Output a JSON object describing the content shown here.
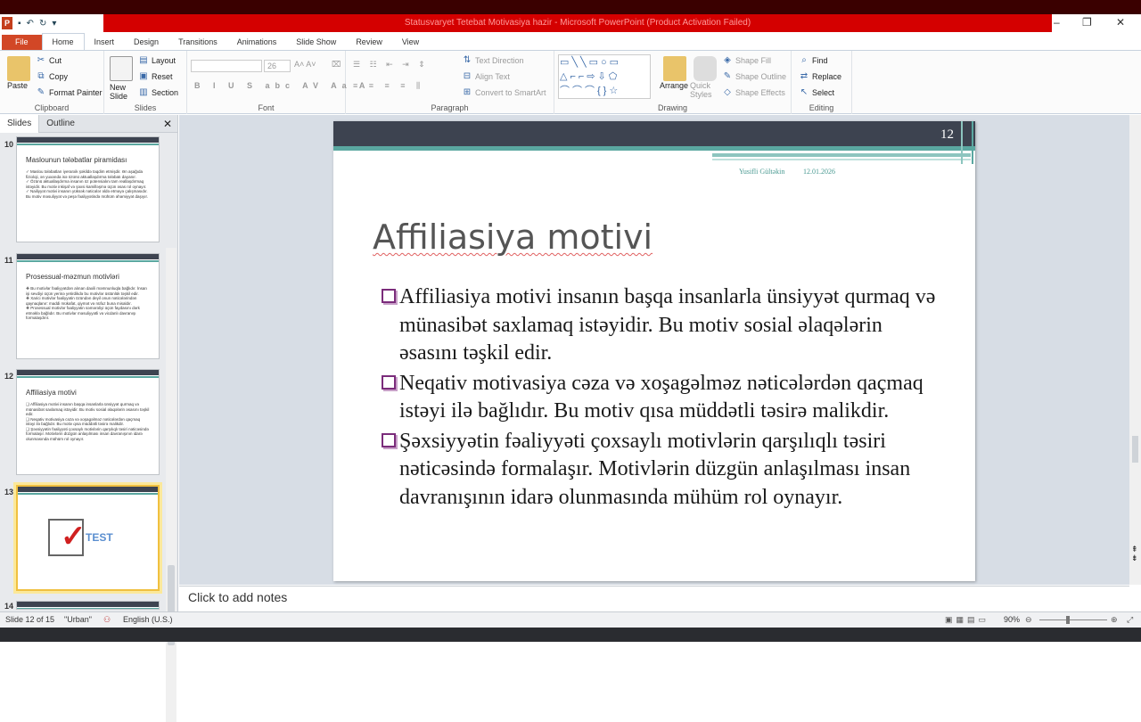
{
  "window": {
    "title": "Statusvaryet Tetebat Motivasiya hazir - Microsoft PowerPoint (Product Activation Failed)"
  },
  "tabs": [
    "File",
    "Home",
    "Insert",
    "Design",
    "Transitions",
    "Animations",
    "Slide Show",
    "Review",
    "View"
  ],
  "ribbon": {
    "clipboard": {
      "paste": "Paste",
      "cut": "Cut",
      "copy": "Copy",
      "format_painter": "Format Painter",
      "label": "Clipboard"
    },
    "slides": {
      "new_slide": "New Slide",
      "layout": "Layout",
      "reset": "Reset",
      "section": "Section",
      "label": "Slides"
    },
    "font": {
      "size": "26",
      "label": "Font"
    },
    "paragraph": {
      "text_direction": "Text Direction",
      "align_text": "Align Text",
      "convert": "Convert to SmartArt",
      "label": "Paragraph"
    },
    "drawing": {
      "arrange": "Arrange",
      "quick_styles": "Quick Styles",
      "shape_fill": "Shape Fill",
      "shape_outline": "Shape Outline",
      "shape_effects": "Shape Effects",
      "label": "Drawing"
    },
    "editing": {
      "find": "Find",
      "replace": "Replace",
      "select": "Select",
      "label": "Editing"
    }
  },
  "left_pane": {
    "tabs": [
      "Slides",
      "Outline"
    ],
    "thumbs": [
      {
        "num": "10",
        "title": "Maslounun tələbatlar piramidası",
        "body": "✓ Maslou tələbatları iyerarxik şəkildə təqdim etmişdir. Ən aşağıda fizioloji, ən yuxarıda isə özünü aktuallaşdırma tələbatı dayanır.\n✓ Özünü aktuallaşdırma insanın öz potensialını tam reallaşdırmaq istəyidir. Bu motiv inkişaf və şəxsi kamilləşmə üçün əsas rol oynayır.\n✓ Nailiyyət motivi insanın yüksək nəticələr əldə etməyə çalışmasıdır. Bu motiv məsuliyyət və peşə fəaliyyətində mühüm əhəmiyyət daşıyır."
      },
      {
        "num": "11",
        "title": "Prosessual-məzmun motivləri",
        "body": "❖ Bu motivlər fəaliyyətdən alınan daxili məmnunluqla bağlıdır. İnsan işi sevdiyi üçün yerinə yetirdikdə bu motivlər üstünlük təşkil edir.\n❖ Xarici motivlər fəaliyyətin özündən deyil onun nəticələrindən qaynaqlanır: maddi mükafat, qiymət və nüfuz buna misaldır.\n❖ Prosessual motivlər fəaliyyətin səmərəliyi üçün faydasını dərk etməklə bağlıdır. Bu motivlər məsuliyyətli və vicdanlı davranışı formalaşdırır."
      },
      {
        "num": "12",
        "title": "Affiliasiya motivi",
        "body": "❑ Affiliasiya motivi insanın başqa insanlarla ünsiyyət qurmaq və münasibət saxlamaq istəyidir. Bu motiv sosial əlaqələrin əsasını təşkil edir.\n❑ Neqativ motivasiya cəza və xoşagəlməz nəticələrdən qaçmaq istəyi ilə bağlıdır. Bu motiv qısa müddətli təsirə malikdir.\n❑ Şəxsiyyətin fəaliyyəti çoxsaylı motivlərin qarşılıqlı təsiri nəticəsində formalaşır. Motivlərin düzgün anlaşılması insan davranışının idarə olunmasında mühüm rol oynayır."
      },
      {
        "num": "13",
        "title": "",
        "body": ""
      },
      {
        "num": "14",
        "title": "",
        "body": ""
      }
    ]
  },
  "slide": {
    "number": "12",
    "author": "Yusifli Gültəkin",
    "date": "12.01.2026",
    "title": "Affiliasiya motivi",
    "bullets": [
      "Affiliasiya motivi insanın başqa insanlarla ünsiyyət qurmaq və münasibət saxlamaq istəyidir.  Bu motiv sosial əlaqələrin əsasını təşkil edir.",
      "Neqativ motivasiya cəza və xoşagəlməz nəticələrdən qaçmaq istəyi ilə bağlıdır. Bu motiv qısa müddətli təsirə malikdir.",
      "Şəxsiyyətin fəaliyyəti çoxsaylı motivlərin qarşılıqlı təsiri nəticəsində formalaşır. Motivlərin düzgün anlaşılması insan davranışının idarə olunmasında mühüm rol oynayır."
    ]
  },
  "notes": {
    "placeholder": "Click to add notes"
  },
  "status": {
    "slide": "Slide 12 of 15",
    "theme": "\"Urban\"",
    "lang": "English (U.S.)",
    "zoom": "90%"
  }
}
